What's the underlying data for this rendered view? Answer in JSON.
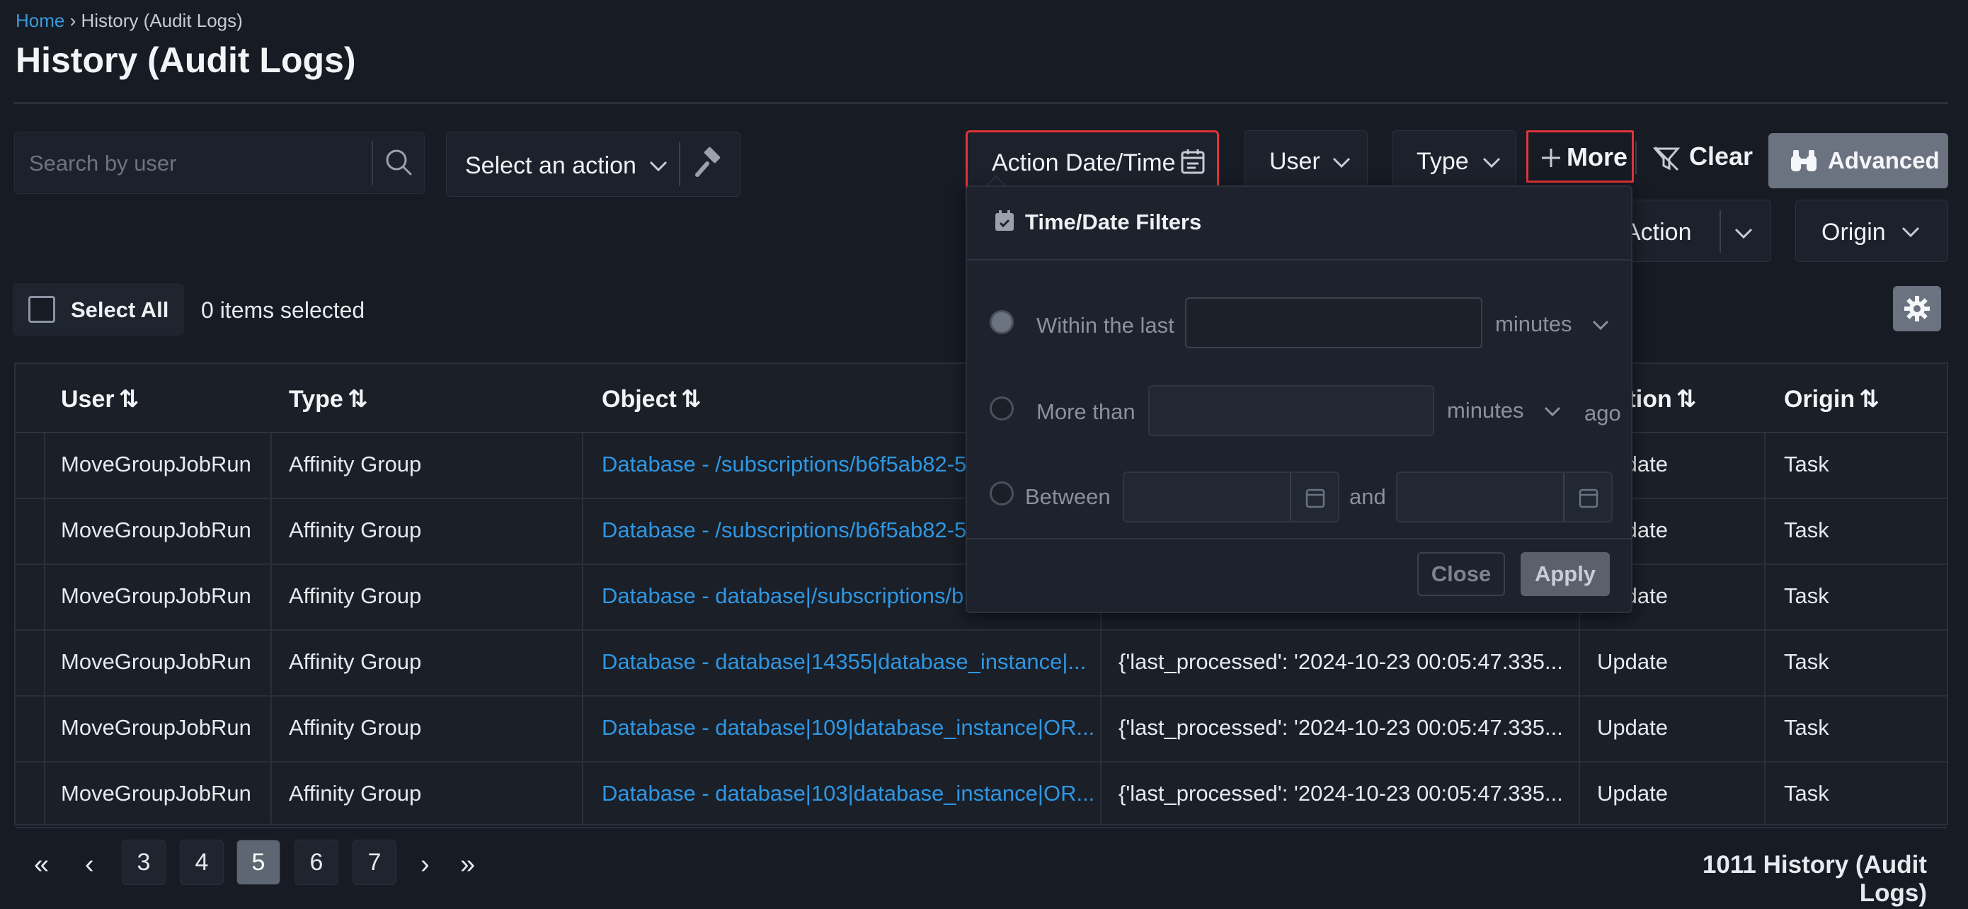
{
  "breadcrumb": {
    "home": "Home",
    "sep": "›",
    "current": "History (Audit Logs)"
  },
  "page": {
    "title": "History (Audit Logs)"
  },
  "toolbar": {
    "search_placeholder": "Search by user",
    "action_select": "Select an action",
    "date_filter": "Action Date/Time",
    "user_filter": "User",
    "type_filter": "Type",
    "more": "More",
    "clear": "Clear",
    "advanced": "Advanced",
    "row2_action": "Action",
    "row2_origin": "Origin"
  },
  "selection": {
    "select_all": "Select All",
    "items_selected": "0 items selected"
  },
  "table": {
    "headers": [
      "User",
      "Type",
      "Object",
      "",
      "Action",
      "Origin"
    ],
    "sort_glyph": "⇅",
    "rows": [
      {
        "user": "MoveGroupJobRun",
        "type": "Affinity Group",
        "object": "Database - /subscriptions/b6f5ab82-5",
        "details": "",
        "action": "Update",
        "origin": "Task"
      },
      {
        "user": "MoveGroupJobRun",
        "type": "Affinity Group",
        "object": "Database - /subscriptions/b6f5ab82-5",
        "details": "",
        "action": "Update",
        "origin": "Task"
      },
      {
        "user": "MoveGroupJobRun",
        "type": "Affinity Group",
        "object": "Database - database|/subscriptions/b",
        "details": "",
        "action": "Update",
        "origin": "Task"
      },
      {
        "user": "MoveGroupJobRun",
        "type": "Affinity Group",
        "object": "Database - database|14355|database_instance|...",
        "details": "{'last_processed': '2024-10-23 00:05:47.335...",
        "action": "Update",
        "origin": "Task"
      },
      {
        "user": "MoveGroupJobRun",
        "type": "Affinity Group",
        "object": "Database - database|109|database_instance|OR...",
        "details": "{'last_processed': '2024-10-23 00:05:47.335...",
        "action": "Update",
        "origin": "Task"
      },
      {
        "user": "MoveGroupJobRun",
        "type": "Affinity Group",
        "object": "Database - database|103|database_instance|OR...",
        "details": "{'last_processed': '2024-10-23 00:05:47.335...",
        "action": "Update",
        "origin": "Task"
      }
    ]
  },
  "popover": {
    "title": "Time/Date Filters",
    "within_last": "Within the last",
    "more_than": "More than",
    "between": "Between",
    "unit": "minutes",
    "ago": "ago",
    "and": "and",
    "close": "Close",
    "apply": "Apply"
  },
  "pagination": {
    "first": "«",
    "prev": "‹",
    "pages": [
      "3",
      "4",
      "5",
      "6",
      "7"
    ],
    "current": "5",
    "next": "›",
    "last": "»",
    "total": "1011 History (Audit Logs)"
  },
  "colors": {
    "accent": "#2f97e3",
    "highlight_border": "#e0333a",
    "background": "#161b24"
  }
}
